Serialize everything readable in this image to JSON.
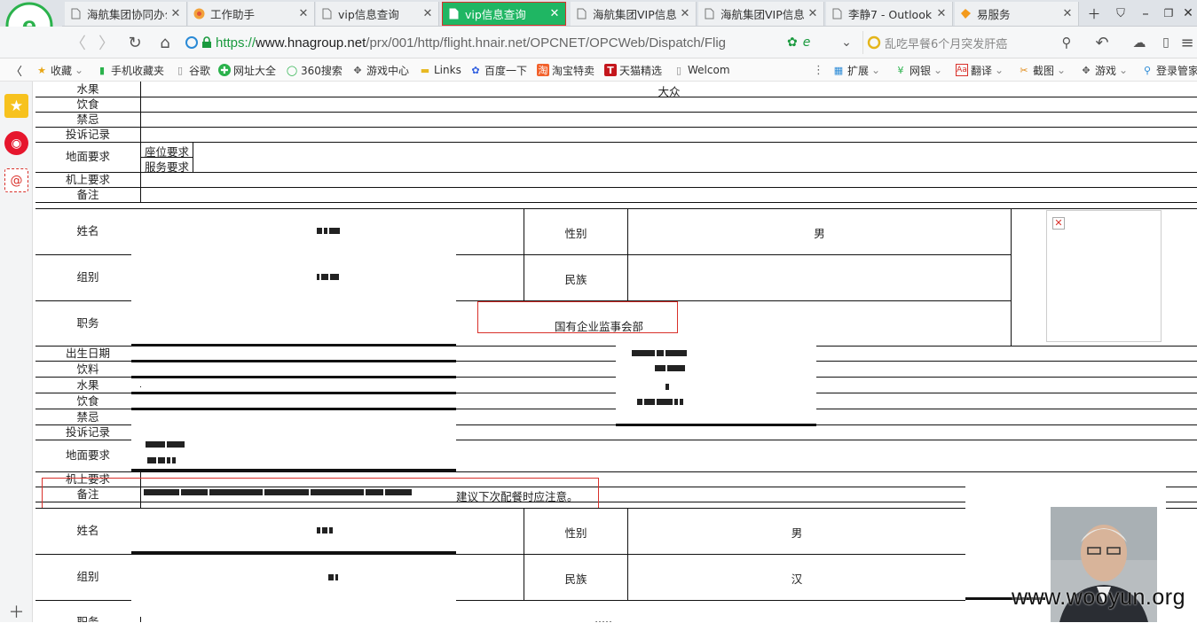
{
  "tabs": [
    {
      "title": "海航集团协同办公",
      "icon": "page-icon",
      "active": false
    },
    {
      "title": "工作助手",
      "icon": "assistant-icon",
      "active": false
    },
    {
      "title": "vip信息查询",
      "icon": "page-icon",
      "active": false
    },
    {
      "title": "vip信息查询",
      "icon": "page-icon",
      "active": true
    },
    {
      "title": "海航集团VIP信息",
      "icon": "page-icon",
      "active": false
    },
    {
      "title": "海航集团VIP信息",
      "icon": "page-icon",
      "active": false
    },
    {
      "title": "李静7 - Outlook",
      "icon": "page-icon",
      "active": false
    },
    {
      "title": "易服务",
      "icon": "service-icon",
      "active": false
    }
  ],
  "address": {
    "scheme": "https://",
    "host": "www.hnagroup.net",
    "path": "/prx/001/http/flight.hnair.net/OPCNET/OPCWeb/Dispatch/Flig",
    "search_text": "乱吃早餐6个月突发肝癌"
  },
  "bookmarks": {
    "favorites": "收藏",
    "mobile": "手机收藏夹",
    "google": "谷歌",
    "sites": "网址大全",
    "search360": "360搜索",
    "games": "游戏中心",
    "links": "Links",
    "baidu": "百度一下",
    "taobao": "淘宝特卖",
    "tmall": "天猫精选",
    "welcome": "Welcom",
    "extensions": "扩展",
    "bank": "网银",
    "translate": "翻译",
    "screenshot": "截图",
    "games2": "游戏",
    "login": "登录管家"
  },
  "record_prev": {
    "fruit_label": "水果",
    "fruit_value": "大众",
    "diet_label": "饮食",
    "taboo_label": "禁忌",
    "complaint_label": "投诉记录",
    "ground_label": "地面要求",
    "seat_req": "座位要求",
    "service_req": "服务要求",
    "onboard_label": "机上要求",
    "remark_label": "备注"
  },
  "record1": {
    "name_label": "姓名",
    "gender_label": "性别",
    "gender_value": "男",
    "group_label": "组别",
    "ethnic_label": "民族",
    "ethnic_value": "",
    "position_label": "职务",
    "position_value": "国有企业监事会部",
    "birth_label": "出生日期",
    "drink_label": "饮料",
    "fruit_label": "水果",
    "diet_label": "饮食",
    "taboo_label": "禁忌",
    "complaint_label": "投诉记录",
    "ground_label": "地面要求",
    "onboard_label": "机上要求",
    "remark_label": "备注",
    "remark_value": "建议下次配餐时应注意。"
  },
  "record2": {
    "name_label": "姓名",
    "gender_label": "性别",
    "gender_value": "男",
    "group_label": "组别",
    "ethnic_label": "民族",
    "ethnic_value": "汉",
    "position_label": "职务"
  },
  "watermark": "www.wooyun.org",
  "colors": {
    "active_tab": "#1fb663",
    "highlight_red": "#d9302a",
    "secure_green": "#1a9a3e"
  }
}
